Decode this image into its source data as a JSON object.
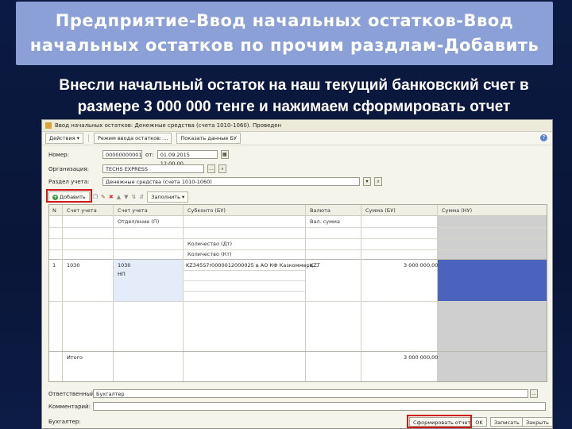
{
  "slide": {
    "title": "Предприятие-Ввод начальных остатков-Ввод\nначальных остатков по прочим раздлам-Добавить",
    "subtitle": "Внесли начальный остаток на наш текущий банковский счет в размере 3 000 000 тенге и нажимаем сформировать отчет"
  },
  "window": {
    "title": "Ввод начальных остатков: Денежные средства (счета 1010-1060). Проведен",
    "toolbar": {
      "actions": "Действия ▾",
      "mode": "Режим ввода остатков: ...",
      "show": "Показать данные БУ"
    },
    "form": {
      "number_label": "Номер:",
      "number_value": "00000000001",
      "from_label": "от:",
      "date_value": "01.09.2015 12:00:00",
      "org_label": "Организация:",
      "org_value": "TECHS EXPRESS",
      "section_label": "Раздел учета:",
      "section_value": "Денежные средства (счета 1010-1060)"
    },
    "table_toolbar": {
      "add": "Добавить",
      "fill": "Заполнить ▾"
    },
    "table": {
      "headers": {
        "n": "N",
        "account": "Счет учета",
        "subaccount": "Субконто (БУ)",
        "currency": "Валюта",
        "sum_buh": "Сумма (БУ)",
        "sum_tax": "Сумма (НУ)"
      },
      "subheaders": {
        "division": "Отдел/ение (П)",
        "cur_sum": "Вал. сумма",
        "qty_dt": "Количество (Дт)",
        "qty_kt": "Количество (Кт)"
      },
      "rows": [
        {
          "n": "1",
          "code": "1030",
          "account": "1030",
          "account2": "НП",
          "subaccount": "KZ345S7r0000012000025 в АО КФ Казкоммерц...",
          "currency": "KZT",
          "sum": "3 000 000,00"
        }
      ],
      "total_label": "Итого",
      "total_value": "3 000 000,00"
    },
    "bottom": {
      "responsible_label": "Ответственный:",
      "responsible_value": "Бухгалтер",
      "comment_label": "Комментарий:",
      "accountant_label": "Бухгалтер:",
      "report_button": "Сформировать отчет",
      "ok_button": "OK",
      "save_button": "Записать",
      "close_button": "Закрыть"
    }
  },
  "colors": {
    "title_bg": "#8aa0d6",
    "slide_bg": "#0a1638",
    "highlight": "#d01818",
    "selected_cell": "#4b63bd"
  }
}
